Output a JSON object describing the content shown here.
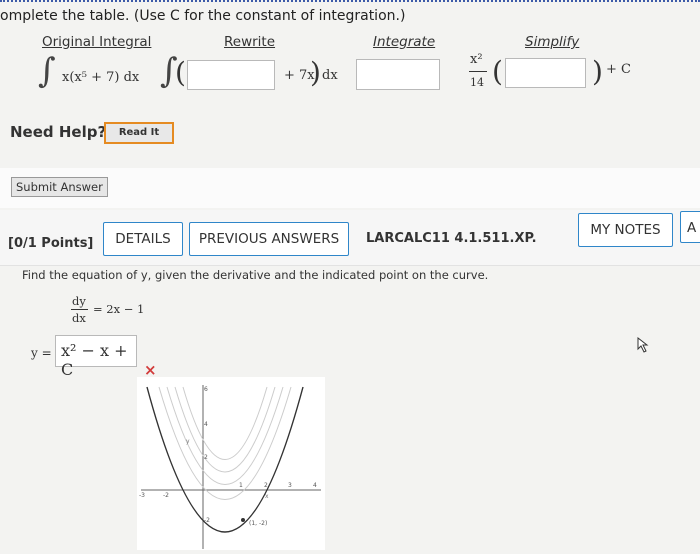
{
  "instruction": "omplete the table. (Use C for the constant of integration.)",
  "columns": {
    "original": "Original Integral",
    "rewrite": "Rewrite",
    "integrate": "Integrate",
    "simplify": "Simplify"
  },
  "original_integrand": "x(x⁵ + 7) dx",
  "rewrite_tail": "+ 7x",
  "rewrite_dx": "dx",
  "simplify_numerator": "x²",
  "simplify_denominator": "14",
  "simplify_tail": "+ C",
  "need_help": "Need Help?",
  "read_it": "Read It",
  "submit_answer": "Submit Answer",
  "points": "[0/1 Points]",
  "details": "DETAILS",
  "previous_answers": "PREVIOUS ANSWERS",
  "problem_code": "LARCALC11 4.1.511.XP.",
  "my_notes": "MY NOTES",
  "next_button_partial": "A",
  "problem_text": "Find the equation of y, given the derivative and the indicated point on the curve.",
  "deriv_num": "dy",
  "deriv_den": "dx",
  "deriv_rhs": "= 2x − 1",
  "y_label": "y =",
  "answer_value": "x² − x + C",
  "wrong_mark": "×",
  "graph": {
    "x_ticks": [
      "-3",
      "-2",
      "1",
      "2",
      "3",
      "4"
    ],
    "y_ticks": [
      "6",
      "4",
      "2",
      "-2"
    ],
    "x_label": "x",
    "y_label": "y",
    "point_label": "(1, -2)"
  }
}
